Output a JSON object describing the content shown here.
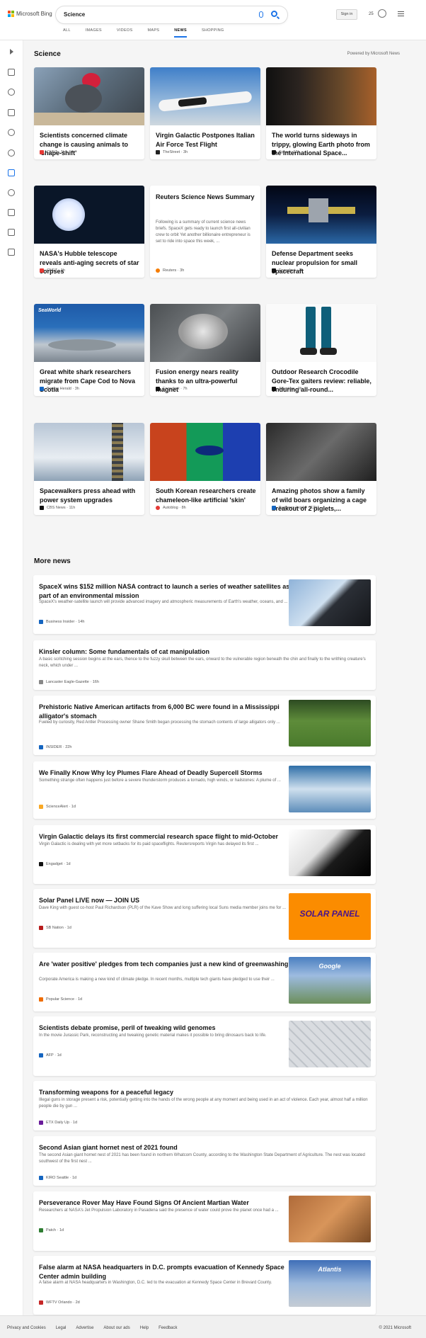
{
  "header": {
    "logo": "Microsoft Bing",
    "query": "Science",
    "tabs": [
      "ALL",
      "IMAGES",
      "VIDEOS",
      "MAPS",
      "NEWS",
      "SHOPPING"
    ],
    "active_tab": "NEWS",
    "sign_in": "Sign in",
    "rewards": "25"
  },
  "section": {
    "title": "Science",
    "powered": "Powered by Microsoft News"
  },
  "cards": [
    {
      "title": "Scientists concerned climate change is causing animals to 'shape-shift'",
      "source": "CNET",
      "time": "1h"
    },
    {
      "title": "Virgin Galactic Postpones Italian Air Force Test Flight",
      "source": "TheStreet",
      "time": "3h"
    },
    {
      "title": "The world turns sideways in trippy, glowing Earth photo from the International Space...",
      "source": "Space",
      "time": "12h"
    },
    {
      "title": "NASA's Hubble telescope reveals anti-aging secrets of star corpses",
      "source": "CNET",
      "time": "1h"
    },
    {
      "title": "Reuters Science News Summary",
      "snippet": "Following is a summary of current science news briefs. SpaceX gets ready to launch first all-civilian crew to orbit Yet another billionaire entrepreneur is set to ride into space this week, ...",
      "source": "Reuters",
      "time": "3h"
    },
    {
      "title": "Defense Department seeks nuclear propulsion for small spacecraft",
      "source": "Engadget",
      "time": "3h"
    },
    {
      "title": "Great white shark researchers migrate from Cape Cod to Nova Scotia",
      "source": "Boston Herald",
      "time": "3h"
    },
    {
      "title": "Fusion energy nears reality thanks to an ultra-powerful magnet",
      "source": "Engadget",
      "time": "7h"
    },
    {
      "title": "Outdoor Research Crocodile Gore-Tex gaiters review: reliable, enduring all-round...",
      "source": "Advnture",
      "time": "9h"
    },
    {
      "title": "Spacewalkers press ahead with power system upgrades",
      "source": "CBS News",
      "time": "11h"
    },
    {
      "title": "South Korean researchers create chameleon-like artificial 'skin'",
      "source": "Autoblog",
      "time": "8h"
    },
    {
      "title": "Amazing photos show a family of wild boars organizing a cage breakout of 2 piglets,...",
      "source": "Business Insider",
      "time": "13h"
    }
  ],
  "more_news": {
    "title": "More news",
    "items": [
      {
        "title": "SpaceX wins $152 million NASA contract to launch a series of weather satellites as part of an environmental mission",
        "snippet": "SpaceX's weather-satellite launch will provide advanced imagery and atmospheric measurements of Earth's weather, oceans, and ...",
        "source": "Business Insider",
        "time": "14h"
      },
      {
        "title": "Kinsler column: Some fundamentals of cat manipulation",
        "snippet": "A basic scritching session begins at the ears, thence to the fuzzy skull between the ears, onward to the vulnerable region beneath the chin and finally to the writhing creature's neck, which under ...",
        "source": "Lancaster Eagle-Gazette",
        "time": "16h"
      },
      {
        "title": "Prehistoric Native American artifacts from 6,000 BC were found in a Mississippi alligator's stomach",
        "snippet": "Fueled by curiosity, Red Antler Processing owner Shane Smith began processing the stomach contents of large alligators only ...",
        "source": "INSIDER",
        "time": "22h"
      },
      {
        "title": "We Finally Know Why Icy Plumes Flare Ahead of Deadly Supercell Storms",
        "snippet": "Something strange often happens just before a severe thunderstorm produces a tornado, high winds, or hailstones: A plume of ...",
        "source": "ScienceAlert",
        "time": "1d"
      },
      {
        "title": "Virgin Galactic delays its first commercial research space flight to mid-October",
        "snippet": "Virgin Galactic is dealing with yet more setbacks for its paid spaceflights. Reutersreports Virgin has delayed its first ...",
        "source": "Engadget",
        "time": "1d"
      },
      {
        "title": "Solar Panel LIVE now — JOIN US",
        "snippet": "Dave King with guest co-host Paul Richardson (PLR) of the Kave Show and long suffering local Suns media member joins me for ...",
        "source": "SB Nation",
        "time": "1d"
      },
      {
        "title": "Are 'water positive' pledges from tech companies just a new kind of greenwashing?",
        "snippet": "Corporate America is making a new kind of climate pledge. In recent months, multiple tech giants have pledged to use their ...",
        "source": "Popular Science",
        "time": "1d"
      },
      {
        "title": "Scientists debate promise, peril of tweaking wild genomes",
        "snippet": "In the movie Jurassic Park, reconstructing and tweaking genetic material makes it possible to bring dinosaurs back to life.",
        "source": "AFP",
        "time": "1d"
      },
      {
        "title": "Transforming weapons for a peaceful legacy",
        "snippet": "Illegal guns in storage present a risk, potentially getting into the hands of the wrong people at any moment and being used in an act of violence. Each year, almost half a million people die by gun ...",
        "source": "ETX Daily Up",
        "time": "1d"
      },
      {
        "title": "Second Asian giant hornet nest of 2021 found",
        "snippet": "The second Asian giant hornet nest of 2021 has been found in northern Whatcom County, according to the Washington State Department of Agriculture. The nest was located southwest of the first nest ...",
        "source": "KIRO Seattle",
        "time": "1d"
      },
      {
        "title": "Perseverance Rover May Have Found Signs Of Ancient Martian Water",
        "snippet": "Researchers at NASA's Jet Propulsion Laboratory in Pasadena said the presence of water could prove the planet once had a ...",
        "source": "Patch",
        "time": "1d"
      },
      {
        "title": "False alarm at NASA headquarters in D.C. prompts evacuation of Kennedy Space Center admin building",
        "snippet": "A false alarm at NASA headquarters in Washington, D.C. led to the evacuation at Kennedy Space Center in Brevard County.",
        "source": "WFTV Orlando",
        "time": "2d"
      }
    ]
  },
  "thumb_texts": {
    "solar_panel": "SOLAR PANEL",
    "google": "Google",
    "atlantis": "Atlantis",
    "seaworld": "SeaWorld"
  },
  "footer": {
    "links": [
      "Privacy and Cookies",
      "Legal",
      "Advertise",
      "About our ads",
      "Help",
      "Feedback"
    ],
    "copyright": "© 2021 Microsoft"
  },
  "colors": {
    "accent": "#1a73e8",
    "logo": [
      "#f25022",
      "#7fba00",
      "#00a4ef",
      "#ffb900"
    ]
  }
}
